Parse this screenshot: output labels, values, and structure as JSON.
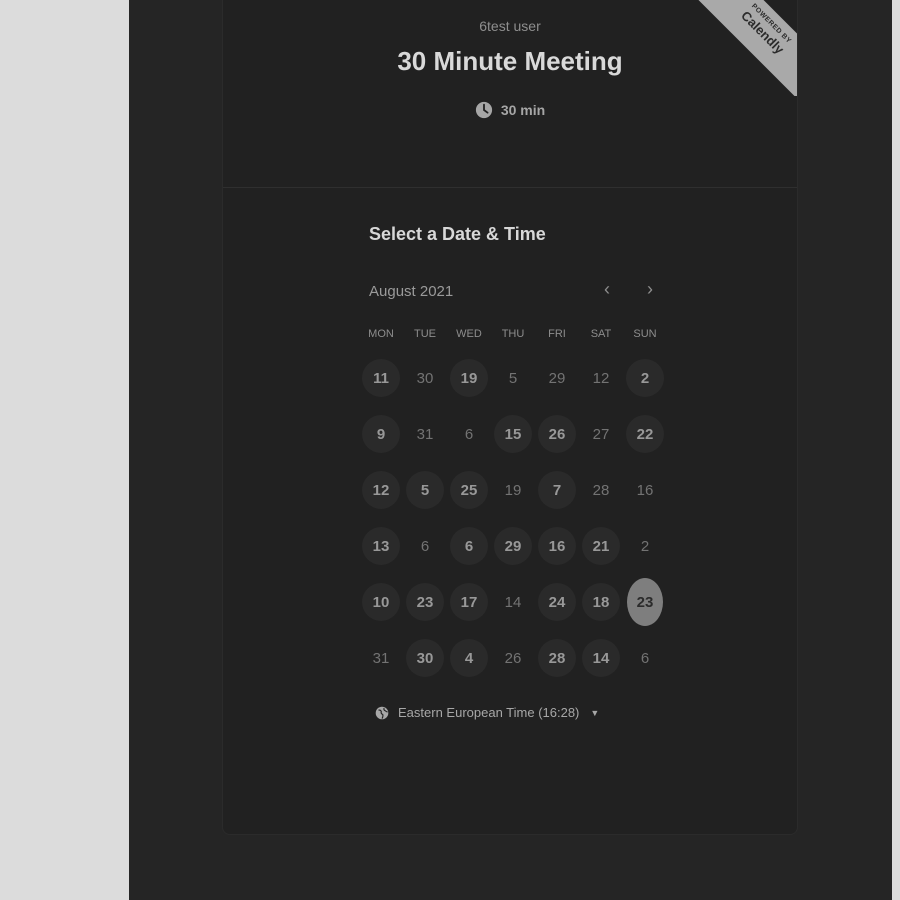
{
  "header": {
    "owner": "6test user",
    "title": "30 Minute Meeting",
    "duration": "30 min"
  },
  "ribbon": {
    "powered_by": "POWERED BY",
    "brand": "Calendly"
  },
  "calendar": {
    "section_title": "Select a Date & Time",
    "month": "August 2021",
    "weekdays": [
      "MON",
      "TUE",
      "WED",
      "THU",
      "FRI",
      "SAT",
      "SUN"
    ],
    "weeks": [
      [
        {
          "d": "11",
          "a": true
        },
        {
          "d": "30",
          "a": false
        },
        {
          "d": "19",
          "a": true
        },
        {
          "d": "5",
          "a": false
        },
        {
          "d": "29",
          "a": false
        },
        {
          "d": "12",
          "a": false
        },
        {
          "d": "2",
          "a": true
        }
      ],
      [
        {
          "d": "9",
          "a": true
        },
        {
          "d": "31",
          "a": false
        },
        {
          "d": "6",
          "a": false
        },
        {
          "d": "15",
          "a": true
        },
        {
          "d": "26",
          "a": true
        },
        {
          "d": "27",
          "a": false
        },
        {
          "d": "22",
          "a": true
        }
      ],
      [
        {
          "d": "12",
          "a": true
        },
        {
          "d": "5",
          "a": true
        },
        {
          "d": "25",
          "a": true
        },
        {
          "d": "19",
          "a": false
        },
        {
          "d": "7",
          "a": true
        },
        {
          "d": "28",
          "a": false
        },
        {
          "d": "16",
          "a": false
        }
      ],
      [
        {
          "d": "13",
          "a": true
        },
        {
          "d": "6",
          "a": false
        },
        {
          "d": "6",
          "a": true
        },
        {
          "d": "29",
          "a": true
        },
        {
          "d": "16",
          "a": true
        },
        {
          "d": "21",
          "a": true
        },
        {
          "d": "2",
          "a": false
        }
      ],
      [
        {
          "d": "10",
          "a": true
        },
        {
          "d": "23",
          "a": true
        },
        {
          "d": "17",
          "a": true
        },
        {
          "d": "14",
          "a": false
        },
        {
          "d": "24",
          "a": true
        },
        {
          "d": "18",
          "a": true
        },
        {
          "d": "23",
          "a": true,
          "selected": true
        }
      ],
      [
        {
          "d": "31",
          "a": false
        },
        {
          "d": "30",
          "a": true
        },
        {
          "d": "4",
          "a": true
        },
        {
          "d": "26",
          "a": false
        },
        {
          "d": "28",
          "a": true
        },
        {
          "d": "14",
          "a": true
        },
        {
          "d": "6",
          "a": false
        }
      ]
    ],
    "timezone": "Eastern European Time (16:28)"
  },
  "colors": {
    "page_bg": "#252525",
    "card_bg": "#212121",
    "outer_bg": "#dcdcdc",
    "selected": "#7e7e7e"
  }
}
